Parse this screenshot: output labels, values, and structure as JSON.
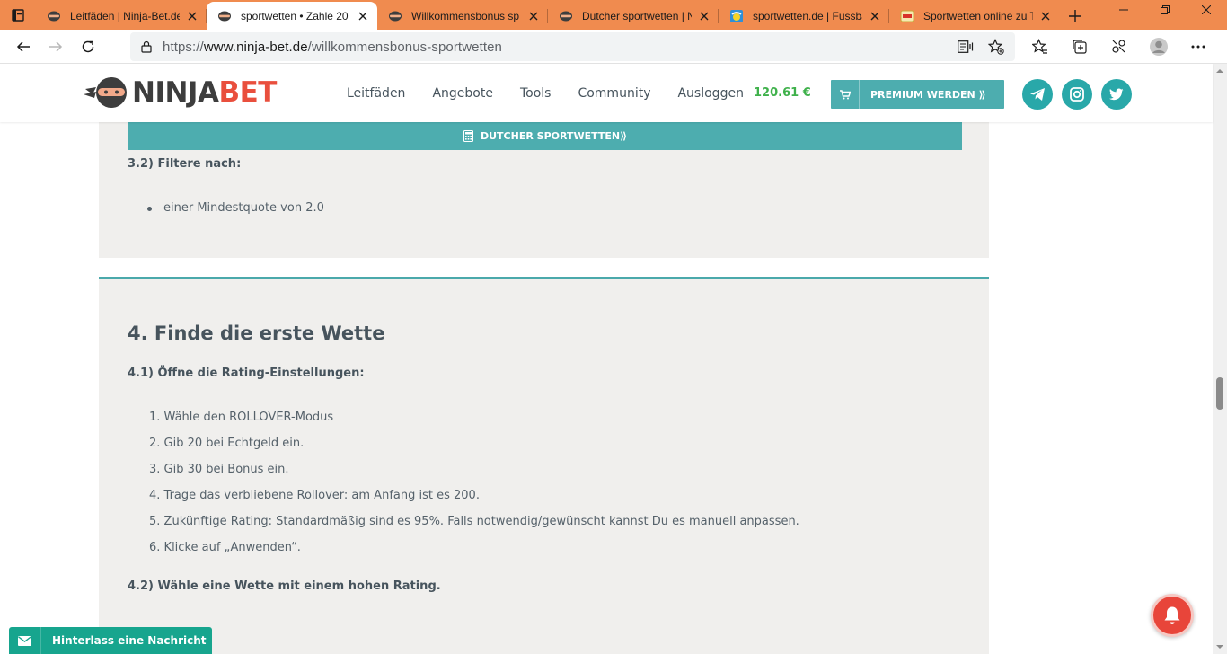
{
  "browser": {
    "tabs": [
      {
        "title": "Leitfäden | Ninja-Bet.de",
        "favicon": "ninja-icon",
        "active": false
      },
      {
        "title": "sportwetten • Zahle 20",
        "favicon": "ninja-icon",
        "active": true
      },
      {
        "title": "Willkommensbonus sp",
        "favicon": "ninja-icon",
        "active": false
      },
      {
        "title": "Dutcher sportwetten | N",
        "favicon": "ninja-icon",
        "active": false
      },
      {
        "title": "sportwetten.de | Fussba",
        "favicon": "sportwetten-icon",
        "active": false
      },
      {
        "title": "Sportwetten online zu T",
        "favicon": "bet-icon",
        "active": false
      }
    ],
    "url": {
      "prefix": "https://",
      "host": "www.ninja-bet.de",
      "path": "/willkommensbonus-sportwetten"
    }
  },
  "site": {
    "logo": {
      "part1": "NINJA",
      "part2": "BET"
    },
    "nav": [
      "Leitfäden",
      "Angebote",
      "Tools",
      "Community",
      "Ausloggen"
    ],
    "balance": "120.61 €",
    "premium_label": "PREMIUM WERDEN ⟫",
    "social": [
      "telegram-icon",
      "instagram-icon",
      "twitter-icon"
    ],
    "colors": {
      "accent": "#4dadaf",
      "brand_red": "#e94f3d",
      "balance_green": "#3fb14b",
      "chat_green": "#17a58e"
    }
  },
  "content": {
    "dutcher_button": "DUTCHER SPORTWETTEN⟫",
    "s32_title": "3.2) Filtere nach:",
    "s32_items": [
      "einer Mindestquote von 2.0"
    ],
    "s4_title": "4. Finde die erste Wette",
    "s41_title": "4.1) Öffne die Rating-Einstellungen:",
    "s41_items": [
      "Wähle den ROLLOVER-Modus",
      "Gib 20 bei Echtgeld ein.",
      " Gib 30 bei Bonus ein.",
      "Trage das verbliebene Rollover: am Anfang ist es 200.",
      "Zukünftige Rating: Standardmäßig sind es 95%. Falls notwendig/gewünscht kannst Du es manuell anpassen.",
      "Klicke auf „Anwenden“."
    ],
    "s42_title": "4.2) Wähle eine Wette mit einem hohen Rating."
  },
  "widgets": {
    "chat_label": "Hinterlass eine Nachricht"
  }
}
